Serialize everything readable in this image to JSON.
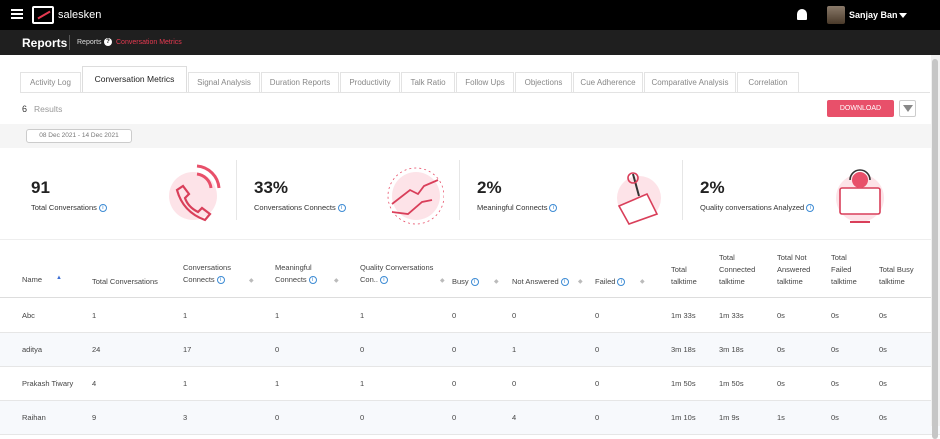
{
  "app": {
    "brand": "salesken",
    "user": "Sanjay Ban"
  },
  "header": {
    "title": "Reports",
    "crumb_parent": "Reports",
    "crumb_current": "Conversation Metrics"
  },
  "tabs": [
    {
      "label": "Activity Log"
    },
    {
      "label": "Conversation Metrics"
    },
    {
      "label": "Signal Analysis"
    },
    {
      "label": "Duration Reports"
    },
    {
      "label": "Productivity"
    },
    {
      "label": "Talk Ratio"
    },
    {
      "label": "Follow Ups"
    },
    {
      "label": "Objections"
    },
    {
      "label": "Cue Adherence"
    },
    {
      "label": "Comparative Analysis"
    },
    {
      "label": "Correlation"
    }
  ],
  "results": {
    "count": "6",
    "label": "Results"
  },
  "download_label": "DOWNLOAD",
  "date_range": "08 Dec 2021 - 14 Dec 2021",
  "stats": [
    {
      "value": "91",
      "label": "Total Conversations"
    },
    {
      "value": "33%",
      "label": "Conversations Connects"
    },
    {
      "value": "2%",
      "label": "Meaningful Connects"
    },
    {
      "value": "2%",
      "label": "Quality conversations Analyzed"
    }
  ],
  "table": {
    "columns": [
      {
        "l1": "",
        "l2": "Name"
      },
      {
        "l1": "",
        "l2": "Total Conversations"
      },
      {
        "l1": "Conversations",
        "l2": "Connects"
      },
      {
        "l1": "Meaningful",
        "l2": "Connects"
      },
      {
        "l1": "Quality Conversations",
        "l2": "Con.."
      },
      {
        "l1": "",
        "l2": "Busy"
      },
      {
        "l1": "",
        "l2": "Not Answered"
      },
      {
        "l1": "",
        "l2": "Failed"
      },
      {
        "l1": "Total",
        "l2": "talktime"
      },
      {
        "l1": "Total Connected",
        "l2": "talktime"
      },
      {
        "l1": "Total Not Answered",
        "l2": "talktime"
      },
      {
        "l1": "Total Failed",
        "l2": "talktime"
      },
      {
        "l1": "Total Busy",
        "l2": "talktime"
      }
    ],
    "rows": [
      [
        "Abc",
        "1",
        "1",
        "1",
        "1",
        "0",
        "0",
        "0",
        "1m 33s",
        "1m 33s",
        "0s",
        "0s",
        "0s"
      ],
      [
        "aditya",
        "24",
        "17",
        "0",
        "0",
        "0",
        "1",
        "0",
        "3m 18s",
        "3m 18s",
        "0s",
        "0s",
        "0s"
      ],
      [
        "Prakash Tiwary",
        "4",
        "1",
        "1",
        "1",
        "0",
        "0",
        "0",
        "1m 50s",
        "1m 50s",
        "0s",
        "0s",
        "0s"
      ],
      [
        "Raihan",
        "9",
        "3",
        "0",
        "0",
        "0",
        "4",
        "0",
        "1m 10s",
        "1m 9s",
        "1s",
        "0s",
        "0s"
      ]
    ]
  },
  "colors": {
    "accent": "#e8506a",
    "topbar": "#000000",
    "link": "#3d8bd4"
  },
  "icons": [
    "menu-icon",
    "salesken-logo",
    "bell-icon",
    "caret-down-icon",
    "help-icon",
    "filter-icon",
    "info-icon",
    "sort-icon"
  ]
}
